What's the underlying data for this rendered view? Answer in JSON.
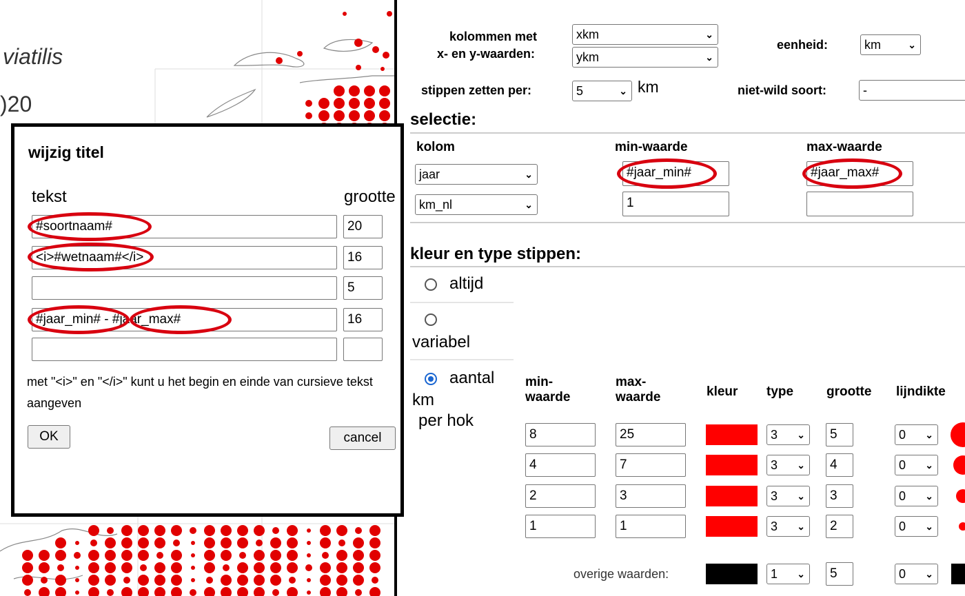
{
  "map": {
    "species_fragment": "viatilis",
    "year_fragment": ")20"
  },
  "dialog": {
    "title": "wijzig titel",
    "col_text": "tekst",
    "col_size": "grootte",
    "rows": [
      {
        "text": "#soortnaam#",
        "size": "20"
      },
      {
        "text": "<i>#wetnaam#</i>",
        "size": "16"
      },
      {
        "text": "",
        "size": "5"
      },
      {
        "text": "#jaar_min# - #jaar_max#",
        "size": "16"
      },
      {
        "text": "",
        "size": ""
      }
    ],
    "hint": "met \"<i>\" en \"</i>\" kunt u het begin en einde van cursieve tekst aangeven",
    "ok": "OK",
    "cancel": "cancel"
  },
  "settings": {
    "columns_label_1": "kolommen met",
    "columns_label_2": "x- en y-waarden:",
    "x_col": "xkm",
    "y_col": "ykm",
    "unit_label": "eenheid:",
    "unit": "km",
    "dots_per_label": "stippen zetten per:",
    "dots_per": "5",
    "dots_per_unit": "km",
    "nonwild_label": "niet-wild soort:",
    "nonwild": "-"
  },
  "selection": {
    "title": "selectie:",
    "col_kolom": "kolom",
    "col_min": "min-waarde",
    "col_max": "max-waarde",
    "rows": [
      {
        "kolom": "jaar",
        "min": "#jaar_min#",
        "max": "#jaar_max#"
      },
      {
        "kolom": "km_nl",
        "min": "1",
        "max": ""
      }
    ]
  },
  "dots": {
    "title": "kleur en type stippen:",
    "opt_always": "altijd",
    "opt_variable": "variabel",
    "opt_count_1": "aantal",
    "opt_count_2": "km",
    "opt_count_3": "per hok",
    "col_min_1": "min-",
    "col_min_2": "waarde",
    "col_max_1": "max-",
    "col_max_2": "waarde",
    "col_color": "kleur",
    "col_type": "type",
    "col_size": "grootte",
    "col_line": "lijndikte",
    "rows": [
      {
        "min": "8",
        "max": "25",
        "type": "3",
        "size": "5",
        "line": "0",
        "color": "#ff0000"
      },
      {
        "min": "4",
        "max": "7",
        "type": "3",
        "size": "4",
        "line": "0",
        "color": "#ff0000"
      },
      {
        "min": "2",
        "max": "3",
        "type": "3",
        "size": "3",
        "line": "0",
        "color": "#ff0000"
      },
      {
        "min": "1",
        "max": "1",
        "type": "3",
        "size": "2",
        "line": "0",
        "color": "#ff0000"
      }
    ],
    "other_label": "overige waarden:",
    "other": {
      "type": "1",
      "size": "5",
      "line": "0",
      "color": "#000000"
    }
  },
  "colors": {
    "highlight": "#d8000f",
    "dot_red": "#e10000"
  }
}
